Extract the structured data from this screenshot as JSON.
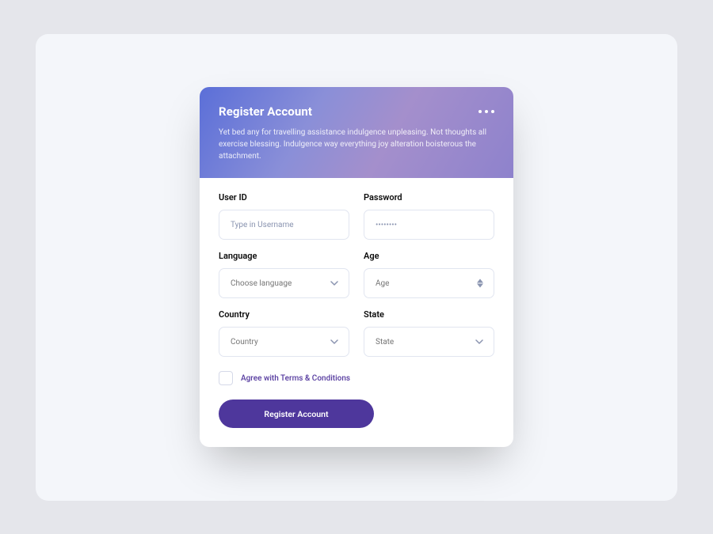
{
  "header": {
    "title": "Register Account",
    "description": "Yet bed any for travelling assistance indulgence unpleasing. Not thoughts all exercise blessing. Indulgence way everything joy alteration boisterous the attachment."
  },
  "fields": {
    "userid": {
      "label": "User ID",
      "placeholder": "Type in Username"
    },
    "password": {
      "label": "Password",
      "placeholder": "••••••••"
    },
    "language": {
      "label": "Language",
      "placeholder": "Choose language"
    },
    "age": {
      "label": "Age",
      "placeholder": "Age"
    },
    "country": {
      "label": "Country",
      "placeholder": "Country"
    },
    "state": {
      "label": "State",
      "placeholder": "State"
    }
  },
  "terms": {
    "label": "Agree with Terms & Conditions"
  },
  "button": {
    "submit": "Register Account"
  }
}
